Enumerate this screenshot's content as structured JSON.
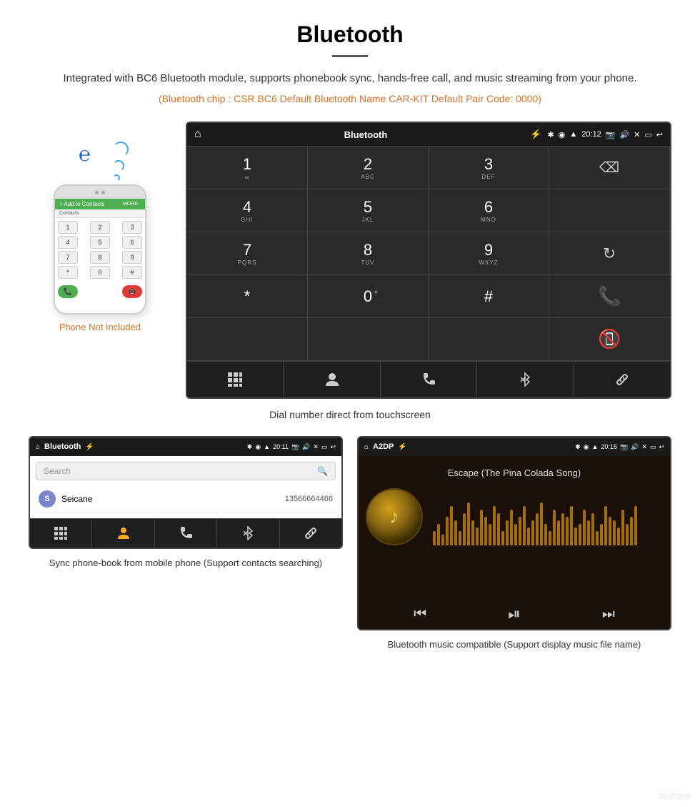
{
  "page": {
    "title": "Bluetooth",
    "description": "Integrated with BC6 Bluetooth module, supports phonebook sync, hands-free call, and music streaming from your phone.",
    "specs": "(Bluetooth chip : CSR BC6    Default Bluetooth Name CAR-KIT    Default Pair Code: 0000)",
    "dial_caption": "Dial number direct from touchscreen",
    "phonebook_caption": "Sync phone-book from mobile phone\n(Support contacts searching)",
    "music_caption": "Bluetooth music compatible\n(Support display music file name)"
  },
  "phone_label": "Phone Not Included",
  "car_screen": {
    "title": "Bluetooth",
    "time": "20:12",
    "status_icon_home": "⌂",
    "status_icon_usb": "⚡",
    "dial_keys": [
      {
        "num": "1",
        "sub": "∞",
        "col": 0
      },
      {
        "num": "2",
        "sub": "ABC",
        "col": 1
      },
      {
        "num": "3",
        "sub": "DEF",
        "col": 2
      },
      {
        "num": "4",
        "sub": "GHI",
        "col": 0
      },
      {
        "num": "5",
        "sub": "JKL",
        "col": 1
      },
      {
        "num": "6",
        "sub": "MNO",
        "col": 2
      },
      {
        "num": "7",
        "sub": "PQRS",
        "col": 0
      },
      {
        "num": "8",
        "sub": "TUV",
        "col": 1
      },
      {
        "num": "9",
        "sub": "WXYZ",
        "col": 2
      },
      {
        "num": "*",
        "sub": "",
        "col": 0
      },
      {
        "num": "0",
        "sub": "+",
        "col": 1
      },
      {
        "num": "#",
        "sub": "",
        "col": 2
      }
    ],
    "bottom_icons": [
      "⠿",
      "👤",
      "📞",
      "✱",
      "🔗"
    ]
  },
  "phonebook_screen": {
    "title": "Bluetooth",
    "time": "20:11",
    "search_placeholder": "Search",
    "contacts": [
      {
        "initial": "S",
        "name": "Seicane",
        "number": "13566664466"
      }
    ]
  },
  "music_screen": {
    "title": "A2DP",
    "time": "20:15",
    "song_title": "Escape (The Pina Colada Song)"
  },
  "wave_heights": [
    20,
    30,
    15,
    40,
    55,
    35,
    20,
    45,
    60,
    35,
    25,
    50,
    40,
    30,
    55,
    45,
    20,
    35,
    50,
    30,
    40,
    55,
    25,
    35,
    45,
    60,
    30,
    20,
    50,
    35,
    45,
    40,
    55,
    25,
    30,
    50,
    35,
    45,
    20,
    30,
    55,
    40,
    35,
    25,
    50,
    30,
    40,
    55
  ]
}
